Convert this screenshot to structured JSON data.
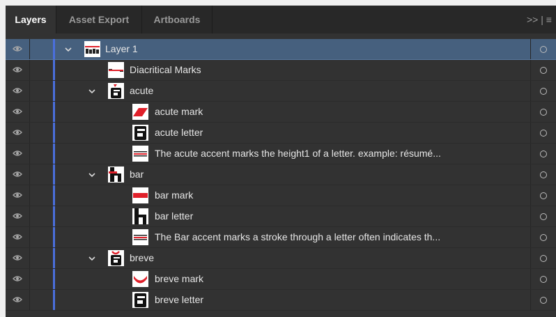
{
  "tabs": [
    {
      "label": "Layers",
      "active": true
    },
    {
      "label": "Asset Export",
      "active": false
    },
    {
      "label": "Artboards",
      "active": false
    }
  ],
  "overflow_label": ">> | ≡",
  "accent_colors": {
    "layer_color": "#4a6fdc",
    "selected_row": "#46607e",
    "thumbnail_mark": "#e0202a"
  },
  "rows": [
    {
      "label": "Layer 1",
      "expanded": true,
      "selected": true,
      "thumb": "layer"
    },
    {
      "label": "Diacritical Marks",
      "thumb": "dash"
    },
    {
      "label": "acute",
      "expanded": true,
      "thumb": "a-acute"
    },
    {
      "label": "acute mark",
      "thumb": "acute-mark"
    },
    {
      "label": "acute letter",
      "thumb": "a-letter"
    },
    {
      "label": "The acute accent marks  the height1 of a letter. example: résumé...",
      "thumb": "text"
    },
    {
      "label": "bar",
      "expanded": true,
      "thumb": "h-bar"
    },
    {
      "label": "bar mark",
      "thumb": "bar-mark"
    },
    {
      "label": "bar letter",
      "thumb": "h-letter"
    },
    {
      "label": "The Bar accent marks a stroke through  a letter often indicates th...",
      "thumb": "text"
    },
    {
      "label": "breve",
      "expanded": true,
      "thumb": "a-breve"
    },
    {
      "label": "breve mark",
      "thumb": "breve-mark"
    },
    {
      "label": "breve letter",
      "thumb": "a-letter"
    }
  ]
}
